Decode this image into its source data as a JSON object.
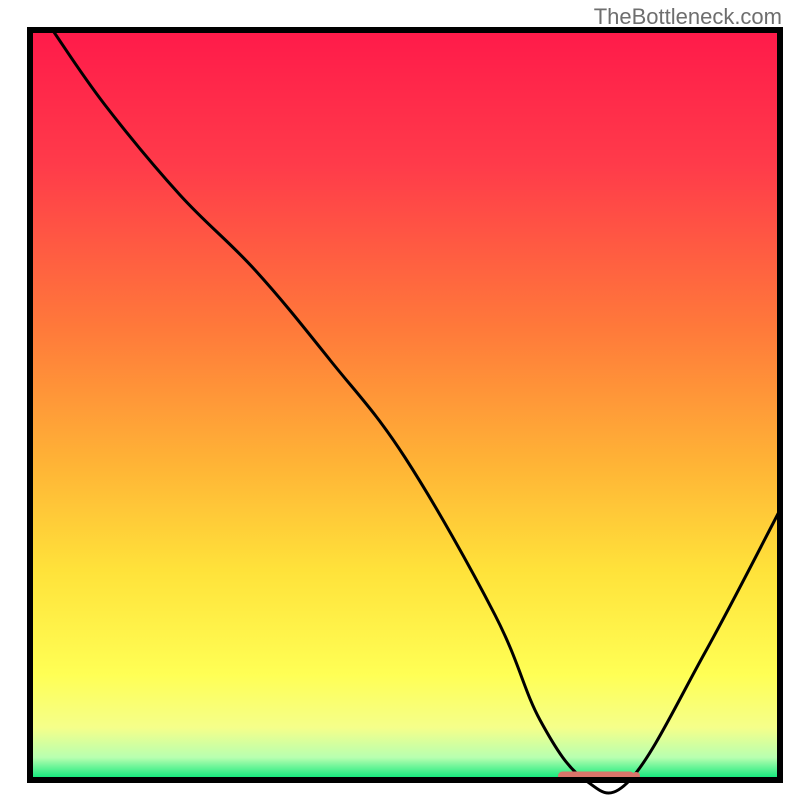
{
  "watermark": "TheBottleneck.com",
  "chart_data": {
    "type": "line",
    "title": "",
    "xlabel": "",
    "ylabel": "",
    "xlim": [
      0,
      100
    ],
    "ylim": [
      0,
      100
    ],
    "grid": false,
    "series": [
      {
        "name": "bottleneck-curve",
        "x": [
          3,
          10,
          20,
          30,
          40,
          50,
          62,
          68,
          74,
          80,
          90,
          100
        ],
        "values": [
          100,
          90,
          78,
          68,
          56,
          43,
          22,
          8,
          0,
          0,
          17,
          36
        ]
      }
    ],
    "marker": {
      "name": "optimal-range",
      "x_start": 71,
      "x_end": 80,
      "y": 0,
      "color": "#d9746a"
    },
    "gradient_stops": [
      {
        "offset": 0.0,
        "color": "#ff1a4a"
      },
      {
        "offset": 0.18,
        "color": "#ff3b4a"
      },
      {
        "offset": 0.4,
        "color": "#ff7a3a"
      },
      {
        "offset": 0.58,
        "color": "#ffb436"
      },
      {
        "offset": 0.72,
        "color": "#ffe23a"
      },
      {
        "offset": 0.86,
        "color": "#ffff55"
      },
      {
        "offset": 0.93,
        "color": "#f5ff8a"
      },
      {
        "offset": 0.97,
        "color": "#b8ffb0"
      },
      {
        "offset": 1.0,
        "color": "#00e676"
      }
    ],
    "frame": {
      "stroke": "#000000",
      "stroke_width": 6
    },
    "curve_style": {
      "stroke": "#000000",
      "stroke_width": 3
    }
  }
}
